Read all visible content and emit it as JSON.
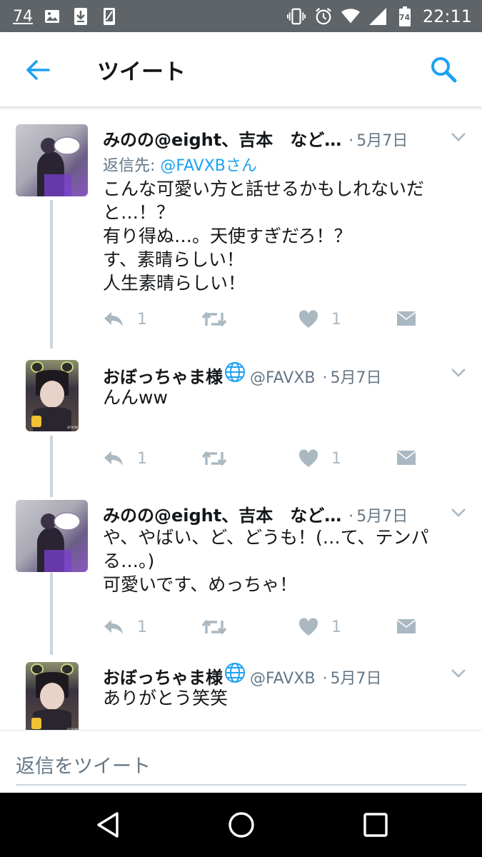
{
  "status_bar": {
    "notification_count": "74",
    "time": "22:11",
    "battery_level": "74",
    "left_icons": [
      "image-icon",
      "download-icon",
      "phone-icon"
    ],
    "right_icons": [
      "vibrate-icon",
      "alarm-icon",
      "wifi-icon",
      "signal-icon",
      "battery-icon"
    ]
  },
  "app_bar": {
    "title": "ツイート"
  },
  "tweets": [
    {
      "name": "みのの@eight、吉本　など…",
      "handle": "",
      "date": "5月7日",
      "reply_to_label": "返信先: ",
      "reply_to_mention": "@FAVXBさん",
      "text": "こんな可愛い方と話せるかもしれないだ\nと…！？\n有り得ぬ…。天使すぎだろ！？\nす、素晴らしい！\n人生素晴らしい！",
      "reply_count": "1",
      "like_count": "1"
    },
    {
      "name": "おぼっちゃま様",
      "handle": "@FAVXB",
      "date": "5月7日",
      "text": "んんww",
      "reply_count": "1",
      "like_count": "1"
    },
    {
      "name": "みのの@eight、吉本　など…",
      "handle": "",
      "date": "5月7日",
      "text": "や、やばい、ど、どうも！(…て、テンパ\nる…。)\n可愛いです、めっちゃ！",
      "reply_count": "1",
      "like_count": "1"
    },
    {
      "name": "おぼっちゃま様",
      "handle": "@FAVXB",
      "date": "5月7日",
      "text": "ありがとう笑笑"
    }
  ],
  "composer": {
    "placeholder": "返信をツイート"
  },
  "colors": {
    "accent": "#1da1f2",
    "status_bar": "#5f6468",
    "secondary_text": "#657786",
    "action_gray": "#aab8c2",
    "thread_line": "#ccd6dd"
  }
}
